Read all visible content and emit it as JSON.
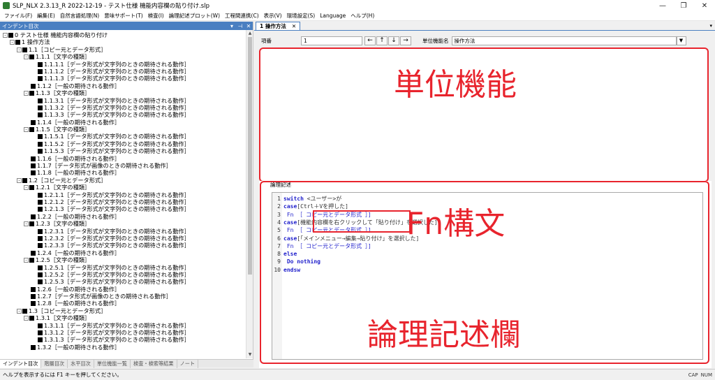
{
  "window": {
    "title": "SLP_NLX 2.3.13_R 2022-12-19 - テスト仕様 機能内容欄の貼り付け.slp"
  },
  "menu": [
    "ファイル(F)",
    "編集(E)",
    "自然言語処理(N)",
    "意味サポート(T)",
    "検査(I)",
    "論理記述プロット(W)",
    "工程間連携(C)",
    "表示(V)",
    "環境設定(S)",
    "Language",
    "ヘルプ(H)"
  ],
  "left_panel": {
    "title": "インデント目次",
    "tree": [
      {
        "level": 0,
        "exp": "-",
        "text": "0 テスト仕様 機能内容欄の貼り付け"
      },
      {
        "level": 1,
        "exp": "-",
        "text": "1 操作方法"
      },
      {
        "level": 2,
        "exp": "-",
        "text": "1.1［コピー元とデータ形式］"
      },
      {
        "level": 3,
        "exp": "-",
        "text": "1.1.1［文字の種類］"
      },
      {
        "level": 4,
        "exp": "",
        "text": "1.1.1.1［データ形式が文字列のときの期待される動作］"
      },
      {
        "level": 4,
        "exp": "",
        "text": "1.1.1.2［データ形式が文字列のときの期待される動作］"
      },
      {
        "level": 4,
        "exp": "",
        "text": "1.1.1.3［データ形式が文字列のときの期待される動作］"
      },
      {
        "level": 3,
        "exp": "",
        "text": "1.1.2［一般の期待される動作］"
      },
      {
        "level": 3,
        "exp": "-",
        "text": "1.1.3［文字の種類］"
      },
      {
        "level": 4,
        "exp": "",
        "text": "1.1.3.1［データ形式が文字列のときの期待される動作］"
      },
      {
        "level": 4,
        "exp": "",
        "text": "1.1.3.2［データ形式が文字列のときの期待される動作］"
      },
      {
        "level": 4,
        "exp": "",
        "text": "1.1.3.3［データ形式が文字列のときの期待される動作］"
      },
      {
        "level": 3,
        "exp": "",
        "text": "1.1.4［一般の期待される動作］"
      },
      {
        "level": 3,
        "exp": "-",
        "text": "1.1.5［文字の種類］"
      },
      {
        "level": 4,
        "exp": "",
        "text": "1.1.5.1［データ形式が文字列のときの期待される動作］"
      },
      {
        "level": 4,
        "exp": "",
        "text": "1.1.5.2［データ形式が文字列のときの期待される動作］"
      },
      {
        "level": 4,
        "exp": "",
        "text": "1.1.5.3［データ形式が文字列のときの期待される動作］"
      },
      {
        "level": 3,
        "exp": "",
        "text": "1.1.6［一般の期待される動作］"
      },
      {
        "level": 3,
        "exp": "",
        "text": "1.1.7［データ形式が画像のときの期待される動作］"
      },
      {
        "level": 3,
        "exp": "",
        "text": "1.1.8［一般の期待される動作］"
      },
      {
        "level": 2,
        "exp": "-",
        "text": "1.2［コピー元とデータ形式］"
      },
      {
        "level": 3,
        "exp": "-",
        "text": "1.2.1［文字の種類］"
      },
      {
        "level": 4,
        "exp": "",
        "text": "1.2.1.1［データ形式が文字列のときの期待される動作］"
      },
      {
        "level": 4,
        "exp": "",
        "text": "1.2.1.2［データ形式が文字列のときの期待される動作］"
      },
      {
        "level": 4,
        "exp": "",
        "text": "1.2.1.3［データ形式が文字列のときの期待される動作］"
      },
      {
        "level": 3,
        "exp": "",
        "text": "1.2.2［一般の期待される動作］"
      },
      {
        "level": 3,
        "exp": "-",
        "text": "1.2.3［文字の種類］"
      },
      {
        "level": 4,
        "exp": "",
        "text": "1.2.3.1［データ形式が文字列のときの期待される動作］"
      },
      {
        "level": 4,
        "exp": "",
        "text": "1.2.3.2［データ形式が文字列のときの期待される動作］"
      },
      {
        "level": 4,
        "exp": "",
        "text": "1.2.3.3［データ形式が文字列のときの期待される動作］"
      },
      {
        "level": 3,
        "exp": "",
        "text": "1.2.4［一般の期待される動作］"
      },
      {
        "level": 3,
        "exp": "-",
        "text": "1.2.5［文字の種類］"
      },
      {
        "level": 4,
        "exp": "",
        "text": "1.2.5.1［データ形式が文字列のときの期待される動作］"
      },
      {
        "level": 4,
        "exp": "",
        "text": "1.2.5.2［データ形式が文字列のときの期待される動作］"
      },
      {
        "level": 4,
        "exp": "",
        "text": "1.2.5.3［データ形式が文字列のときの期待される動作］"
      },
      {
        "level": 3,
        "exp": "",
        "text": "1.2.6［一般の期待される動作］"
      },
      {
        "level": 3,
        "exp": "",
        "text": "1.2.7［データ形式が画像のときの期待される動作］"
      },
      {
        "level": 3,
        "exp": "",
        "text": "1.2.8［一般の期待される動作］"
      },
      {
        "level": 2,
        "exp": "-",
        "text": "1.3［コピー元とデータ形式］"
      },
      {
        "level": 3,
        "exp": "-",
        "text": "1.3.1［文字の種類］"
      },
      {
        "level": 4,
        "exp": "",
        "text": "1.3.1.1［データ形式が文字列のときの期待される動作］"
      },
      {
        "level": 4,
        "exp": "",
        "text": "1.3.1.2［データ形式が文字列のときの期待される動作］"
      },
      {
        "level": 4,
        "exp": "",
        "text": "1.3.1.3［データ形式が文字列のときの期待される動作］"
      },
      {
        "level": 3,
        "exp": "",
        "text": "1.3.2［一般の期待される動作］"
      }
    ],
    "bottom_tabs": [
      "インデント目次",
      "階層目次",
      "水平目次",
      "単位機能一覧",
      "検査・検索等結果",
      "ノート"
    ]
  },
  "doc": {
    "tab_label": "1 操作方法",
    "item_no_label": "項番",
    "item_no_value": "1",
    "nav_buttons": [
      "←",
      "↑",
      "↓",
      "→"
    ],
    "unit_name_label": "単位機能名",
    "unit_name_value": "操作方法",
    "logic_label": "論理記述"
  },
  "annotations": {
    "unit": "単位機能",
    "fn": "Fn構文",
    "logic": "論理記述欄",
    "color": "#e8242d"
  },
  "code": [
    {
      "n": "1",
      "parts": [
        [
          "kw",
          "switch"
        ],
        [
          "txt",
          " <ユーザー>が"
        ]
      ]
    },
    {
      "n": "2",
      "parts": [
        [
          "kw",
          "case"
        ],
        [
          "txt",
          "[Ctrl＋Vを押した]"
        ]
      ]
    },
    {
      "n": "3",
      "parts": [
        [
          "txt",
          "      "
        ],
        [
          "fn",
          "Fn ［ コピー元とデータ形式 ］]"
        ]
      ]
    },
    {
      "n": "4",
      "parts": [
        [
          "kw",
          "case"
        ],
        [
          "txt",
          "[機能内容欄を右クリックして「貼り付け」を選択した]"
        ]
      ]
    },
    {
      "n": "5",
      "parts": [
        [
          "txt",
          "      "
        ],
        [
          "fn",
          "Fn ［ コピー元とデータ形式 ］]"
        ]
      ]
    },
    {
      "n": "6",
      "parts": [
        [
          "kw",
          "case"
        ],
        [
          "txt",
          "[「メインメニュー→編集→貼り付け」を選択した]"
        ]
      ]
    },
    {
      "n": "7",
      "parts": [
        [
          "txt",
          "      "
        ],
        [
          "fn",
          "Fn ［ コピー元とデータ形式 ］]"
        ]
      ]
    },
    {
      "n": "8",
      "parts": [
        [
          "kw",
          "else"
        ]
      ]
    },
    {
      "n": "9",
      "parts": [
        [
          "txt",
          "      "
        ],
        [
          "kw",
          "Do nothing"
        ]
      ]
    },
    {
      "n": "10",
      "parts": [
        [
          "kw",
          "endsw"
        ]
      ]
    }
  ],
  "status": {
    "text": "ヘルプを表示するには F1 キーを押してください。",
    "caps": "CAP",
    "num": "NUM"
  }
}
